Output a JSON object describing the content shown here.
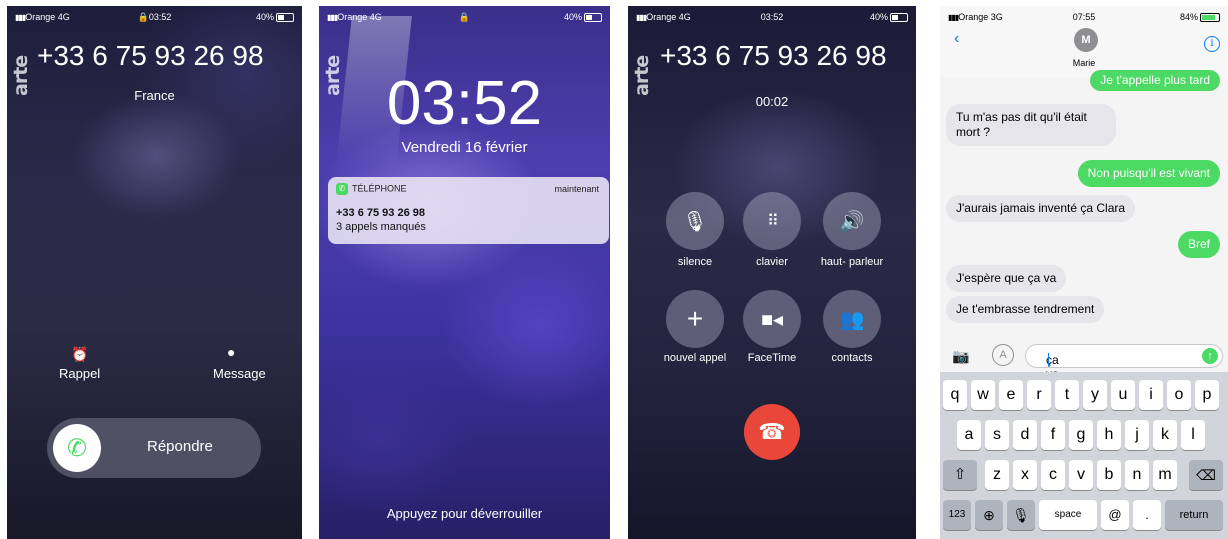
{
  "screen1": {
    "status": {
      "carrier": "Orange",
      "network": "4G",
      "time": "03:52",
      "battery": "40%"
    },
    "brand": "arte",
    "caller_number": "+33 6 75 93 26 98",
    "caller_location": "France",
    "actions": [
      {
        "icon": "alarm-icon",
        "label": "Rappel"
      },
      {
        "icon": "message-bubble-icon",
        "label": "Message"
      }
    ],
    "slider_label": "Répondre",
    "accent": "#4cd964"
  },
  "screen2": {
    "status": {
      "carrier": "Orange",
      "network": "4G",
      "battery": "40%"
    },
    "brand": "arte",
    "time": "03:52",
    "date": "Vendredi 16 février",
    "notification": {
      "app": "TÉLÉPHONE",
      "when": "maintenant",
      "title": "+33 6 75 93 26 98",
      "body": "3 appels manqués"
    },
    "unlock_hint": "Appuyez pour déverrouiller"
  },
  "screen3": {
    "status": {
      "carrier": "Orange",
      "network": "4G",
      "time": "03:52",
      "battery": "40%"
    },
    "brand": "arte",
    "caller_number": "+33 6 75 93 26 98",
    "duration": "00:02",
    "buttons": [
      {
        "icon": "mic-muted-icon",
        "label": "silence"
      },
      {
        "icon": "keypad-icon",
        "label": "clavier"
      },
      {
        "icon": "speaker-icon",
        "label": "haut- parleur"
      },
      {
        "icon": "plus-icon",
        "label": "nouvel appel"
      },
      {
        "icon": "video-camera-icon",
        "label": "FaceTime"
      },
      {
        "icon": "contacts-icon",
        "label": "contacts"
      }
    ],
    "hangup_color": "#e8473a"
  },
  "screen4": {
    "status": {
      "carrier": "Orange",
      "network": "3G",
      "time": "07:55",
      "battery": "84%"
    },
    "contact_initial": "M",
    "contact_name": "Marie",
    "messages": [
      {
        "dir": "out",
        "text": "Je t'appelle plus tard"
      },
      {
        "dir": "in",
        "text": "Tu m'as pas dit qu'il était mort ?"
      },
      {
        "dir": "out",
        "text": "Non puisqu'il est vivant"
      },
      {
        "dir": "in",
        "text": "J'aurais jamais inventé ça Clara"
      },
      {
        "dir": "out",
        "text": "Bref"
      },
      {
        "dir": "in",
        "text": "J'espère que ça va"
      },
      {
        "dir": "in",
        "text": "Je t'embrasse tendrement"
      }
    ],
    "input_value": "ça va",
    "keyboard": {
      "row1": [
        "q",
        "w",
        "e",
        "r",
        "t",
        "y",
        "u",
        "i",
        "o",
        "p"
      ],
      "row2": [
        "a",
        "s",
        "d",
        "f",
        "g",
        "h",
        "j",
        "k",
        "l"
      ],
      "row3": [
        "z",
        "x",
        "c",
        "v",
        "b",
        "n",
        "m"
      ],
      "numbers_key": "123",
      "space_key": "space",
      "at_key": "@",
      "period_key": ".",
      "return_key": "return"
    }
  }
}
